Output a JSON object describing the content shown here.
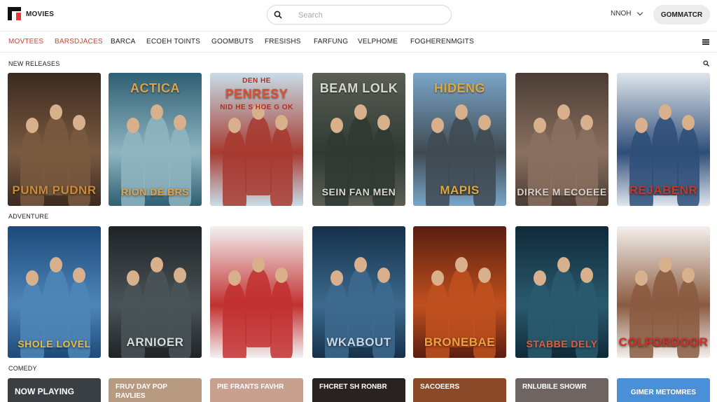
{
  "header": {
    "brand": "MOVIES",
    "search_placeholder": "Search",
    "user_label": "NNOH",
    "action_button": "GOMMATCR"
  },
  "nav": {
    "items": [
      "MOVTEES",
      "BARSDJACES",
      "BARCA",
      "ECOEH TOINTS",
      "GOOMBUTS",
      "FRESISHS",
      "FARFUNG",
      "VELPHOME",
      "FOGHERENMGITS"
    ]
  },
  "sections": {
    "row1_title": "NEW RELEASES",
    "row2_title": "ADVENTURE",
    "row3_title": "COMEDY"
  },
  "row1": [
    {
      "title": "",
      "footer": "PUNM PUDNR",
      "colors": [
        "#3a2a20",
        "#7a5a40",
        "#c98a3a"
      ]
    },
    {
      "title": "ACTICA",
      "footer": "RION DE BRS",
      "colors": [
        "#2f5f73",
        "#8fb5c0",
        "#e0a24a"
      ]
    },
    {
      "title": "PENRESY",
      "subtitle": "NID HE S HOE G OK",
      "top": "DEN  HE",
      "footer": "",
      "colors": [
        "#c7dde8",
        "#a73a30",
        "#e05030"
      ]
    },
    {
      "title": "BEAM LOLK",
      "footer": "SEIN FAN MEN",
      "colors": [
        "#5a5e55",
        "#2f3a33",
        "#d8d8d0"
      ]
    },
    {
      "title": "HIDENG",
      "footer": "MAPIS",
      "colors": [
        "#7aa6c8",
        "#3f4a52",
        "#e0a83a"
      ]
    },
    {
      "title": "",
      "footer": "DIRKE M ECOEEE",
      "colors": [
        "#4a3c34",
        "#8a7060",
        "#d8d0c8"
      ]
    },
    {
      "title": "",
      "footer": "REJABENR",
      "colors": [
        "#dfe6ec",
        "#2e4d78",
        "#c23a2a"
      ]
    }
  ],
  "row2": [
    {
      "title": "",
      "footer": "SHOLE LOVEL",
      "colors": [
        "#1c4a7a",
        "#4f86b8",
        "#e8c040"
      ]
    },
    {
      "title": "",
      "footer": "ARNIOER",
      "colors": [
        "#1e2326",
        "#4a5458",
        "#d8dcdc"
      ]
    },
    {
      "title": "",
      "footer": "",
      "colors": [
        "#f2f2f2",
        "#c23030",
        "#2a4e8a"
      ]
    },
    {
      "title": "",
      "footer": "WKABOUT",
      "colors": [
        "#15314a",
        "#3d6a8e",
        "#c8d8e8"
      ]
    },
    {
      "title": "",
      "footer": "BRONEBAE",
      "colors": [
        "#5a1e10",
        "#c0501e",
        "#f0a040"
      ]
    },
    {
      "title": "",
      "footer": "STABBE DELY",
      "colors": [
        "#0f2a38",
        "#2a5a6e",
        "#e85a3a"
      ]
    },
    {
      "title": "",
      "footer": "COLFORDOOR",
      "colors": [
        "#f4f0ec",
        "#8a5a40",
        "#d0302a"
      ]
    }
  ],
  "row3": [
    {
      "label": "NOW PLAYING",
      "color": "#3a3f44"
    },
    {
      "label": "FRUV DAY POP RAVLIES",
      "color": "#b89a80"
    },
    {
      "label": "PIE FRANTS FAVHR",
      "color": "#c8a090"
    },
    {
      "label": "FHCRET SH RONBR",
      "color": "#2a2220"
    },
    {
      "label": "SACOEERS",
      "color": "#8a4a2a"
    },
    {
      "label": "RNLUBILE SHOWR",
      "color": "#6e6462"
    },
    {
      "label": "GIMER METOMRES",
      "color": "#4a90d8"
    }
  ]
}
